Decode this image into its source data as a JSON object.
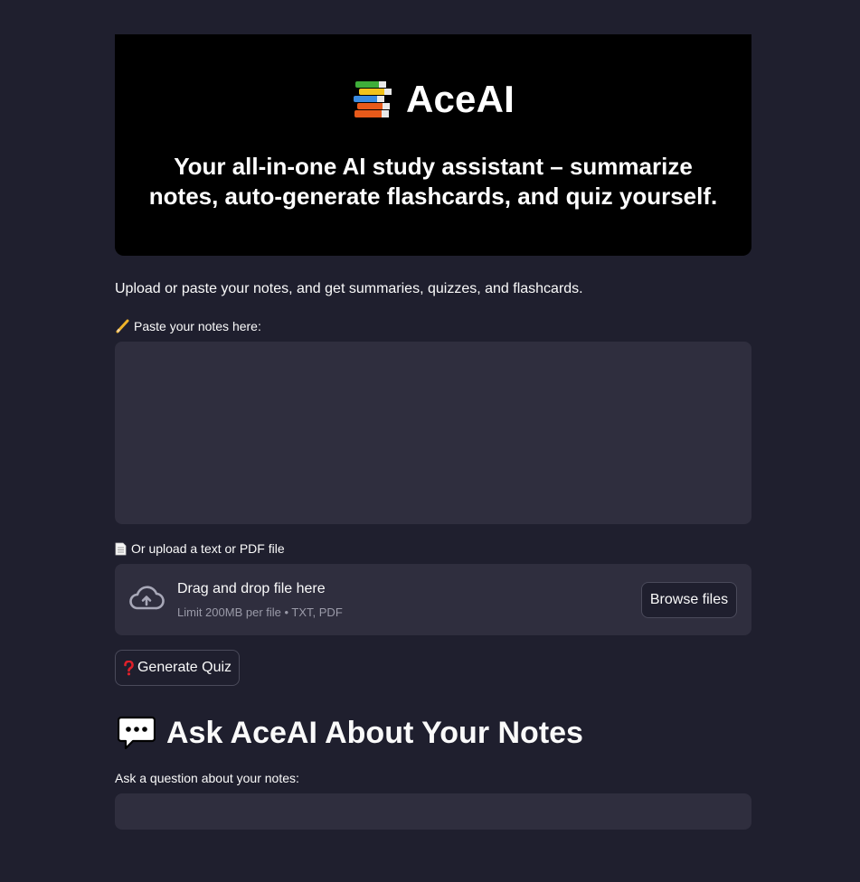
{
  "hero": {
    "title": "AceAI",
    "subtitle": "Your all-in-one AI study assistant – summarize notes, auto-generate flashcards, and quiz yourself."
  },
  "intro": "Upload or paste your notes, and get summaries, quizzes, and flashcards.",
  "notes": {
    "label": "Paste your notes here:",
    "value": ""
  },
  "upload": {
    "label": "Or upload a text or PDF file",
    "drop_title": "Drag and drop file here",
    "drop_limit": "Limit 200MB per file • TXT, PDF",
    "browse_label": "Browse files"
  },
  "quiz": {
    "button_label": "Generate Quiz"
  },
  "ask": {
    "heading": "Ask AceAI About Your Notes",
    "label": "Ask a question about your notes:",
    "value": ""
  },
  "icons": {
    "hero": "books-icon",
    "notes": "pencil-icon",
    "upload": "page-icon",
    "dropzone": "cloud-upload-icon",
    "quiz": "question-mark-icon",
    "ask": "speech-bubble-icon"
  },
  "colors": {
    "background": "#1f1f2e",
    "hero_background": "#000000",
    "input_background": "#2f2e3e",
    "text": "#fafafa",
    "muted_text": "#9a9aa8",
    "quiz_icon": "#e0202a"
  }
}
